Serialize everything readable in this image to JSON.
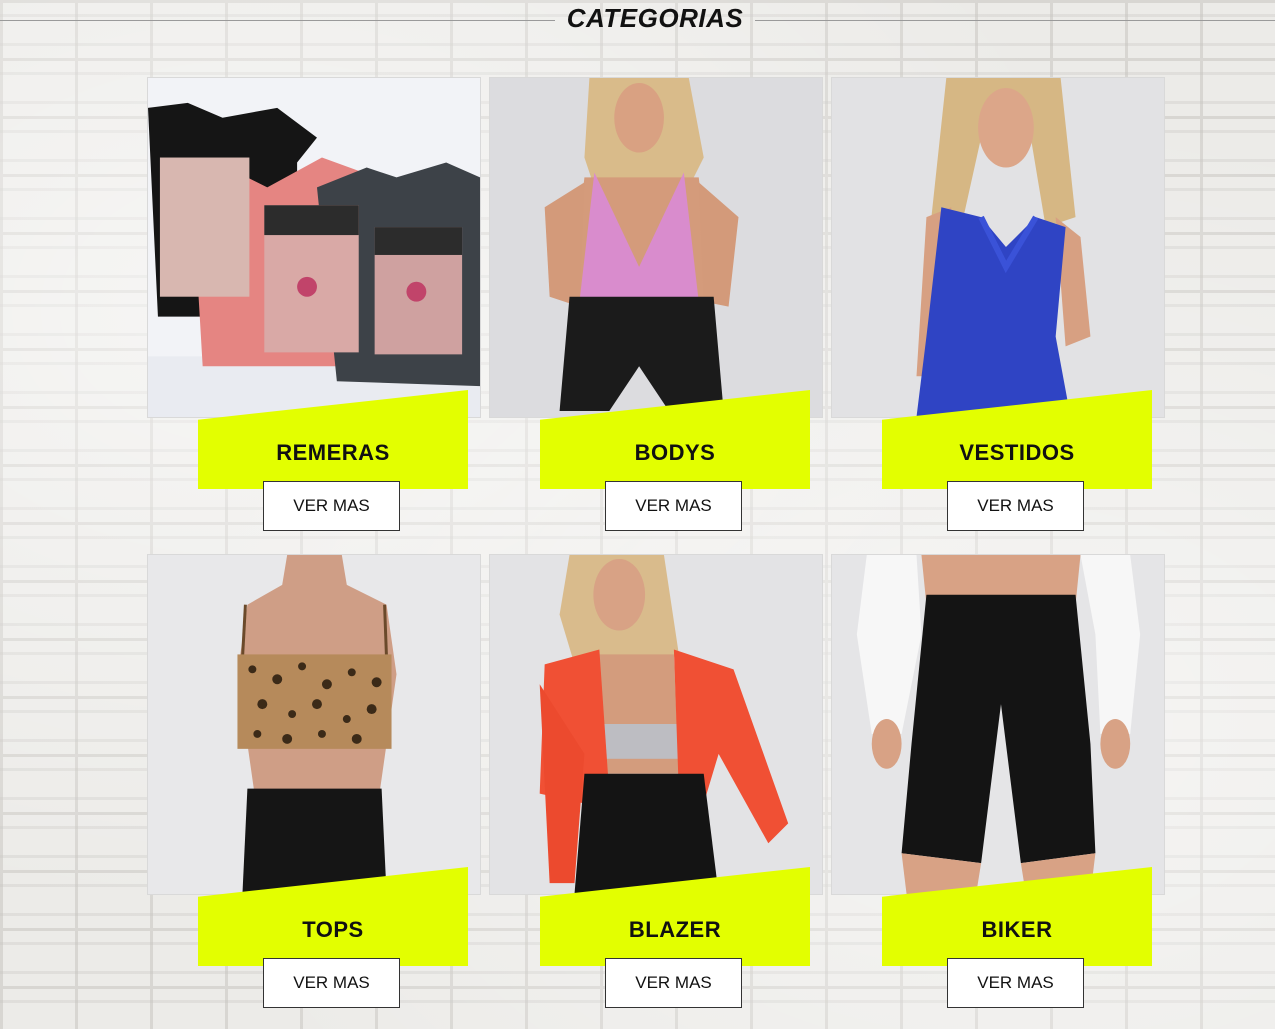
{
  "section": {
    "title": "CATEGORIAS"
  },
  "categories": [
    {
      "label": "REMERAS",
      "button": "VER MAS"
    },
    {
      "label": "BODYS",
      "button": "VER MAS"
    },
    {
      "label": "VESTIDOS",
      "button": "VER MAS"
    },
    {
      "label": "TOPS",
      "button": "VER MAS"
    },
    {
      "label": "BLAZER",
      "button": "VER MAS"
    },
    {
      "label": "BIKER",
      "button": "VER MAS"
    }
  ],
  "colors": {
    "accent": "#e3ff00",
    "text": "#111111",
    "button_bg": "#ffffff"
  }
}
